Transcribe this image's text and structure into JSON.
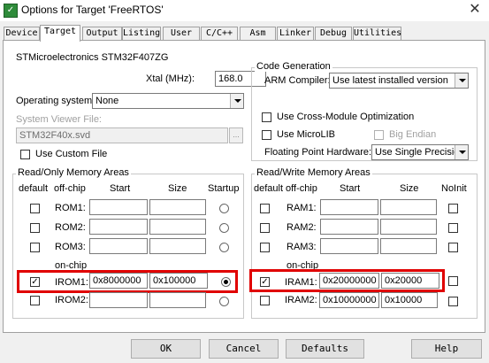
{
  "window": {
    "title": "Options for Target 'FreeRTOS'",
    "close_glyph": "✕",
    "icon_letter": "✓"
  },
  "tabs": [
    "Device",
    "Target",
    "Output",
    "Listing",
    "User",
    "C/C++",
    "Asm",
    "Linker",
    "Debug",
    "Utilities"
  ],
  "target": {
    "device_name": "STMicroelectronics STM32F407ZG",
    "xtal_label": "Xtal (MHz):",
    "xtal_value": "168.0",
    "os_label": "Operating system:",
    "os_value": "None",
    "svf_label": "System Viewer File:",
    "svf_value": "STM32F40x.svd",
    "svf_browse": "...",
    "custom_file_label": "Use Custom File"
  },
  "codegen": {
    "title": "Code Generation",
    "arm_compiler_label": "ARM Compiler:",
    "arm_compiler_value": "Use latest installed version",
    "cross_module_label": "Use Cross-Module Optimization",
    "microlib_label": "Use MicroLIB",
    "big_endian_label": "Big Endian",
    "fph_label": "Floating Point Hardware:",
    "fph_value": "Use Single Precision"
  },
  "ro": {
    "title": "Read/Only Memory Areas",
    "headers": {
      "default": "default",
      "offchip": "off-chip",
      "start": "Start",
      "size": "Size",
      "extra": "Startup"
    },
    "onchip_label": "on-chip",
    "rows": [
      {
        "name": "ROM1:",
        "start": "",
        "size": "",
        "checked": false,
        "startup": false
      },
      {
        "name": "ROM2:",
        "start": "",
        "size": "",
        "checked": false,
        "startup": false
      },
      {
        "name": "ROM3:",
        "start": "",
        "size": "",
        "checked": false,
        "startup": false
      },
      {
        "name": "IROM1:",
        "start": "0x8000000",
        "size": "0x100000",
        "checked": true,
        "startup": true
      },
      {
        "name": "IROM2:",
        "start": "",
        "size": "",
        "checked": false,
        "startup": false
      }
    ]
  },
  "rw": {
    "title": "Read/Write Memory Areas",
    "headers": {
      "default": "default",
      "offchip": "off-chip",
      "start": "Start",
      "size": "Size",
      "extra": "NoInit"
    },
    "onchip_label": "on-chip",
    "rows": [
      {
        "name": "RAM1:",
        "start": "",
        "size": "",
        "checked": false,
        "noinit": false
      },
      {
        "name": "RAM2:",
        "start": "",
        "size": "",
        "checked": false,
        "noinit": false
      },
      {
        "name": "RAM3:",
        "start": "",
        "size": "",
        "checked": false,
        "noinit": false
      },
      {
        "name": "IRAM1:",
        "start": "0x20000000",
        "size": "0x20000",
        "checked": true,
        "noinit": false
      },
      {
        "name": "IRAM2:",
        "start": "0x10000000",
        "size": "0x10000",
        "checked": false,
        "noinit": false
      }
    ]
  },
  "buttons": {
    "ok": "OK",
    "cancel": "Cancel",
    "defaults": "Defaults",
    "help": "Help"
  },
  "colors": {
    "highlight": "#e00000",
    "icon_green": "#2e8b3a"
  }
}
